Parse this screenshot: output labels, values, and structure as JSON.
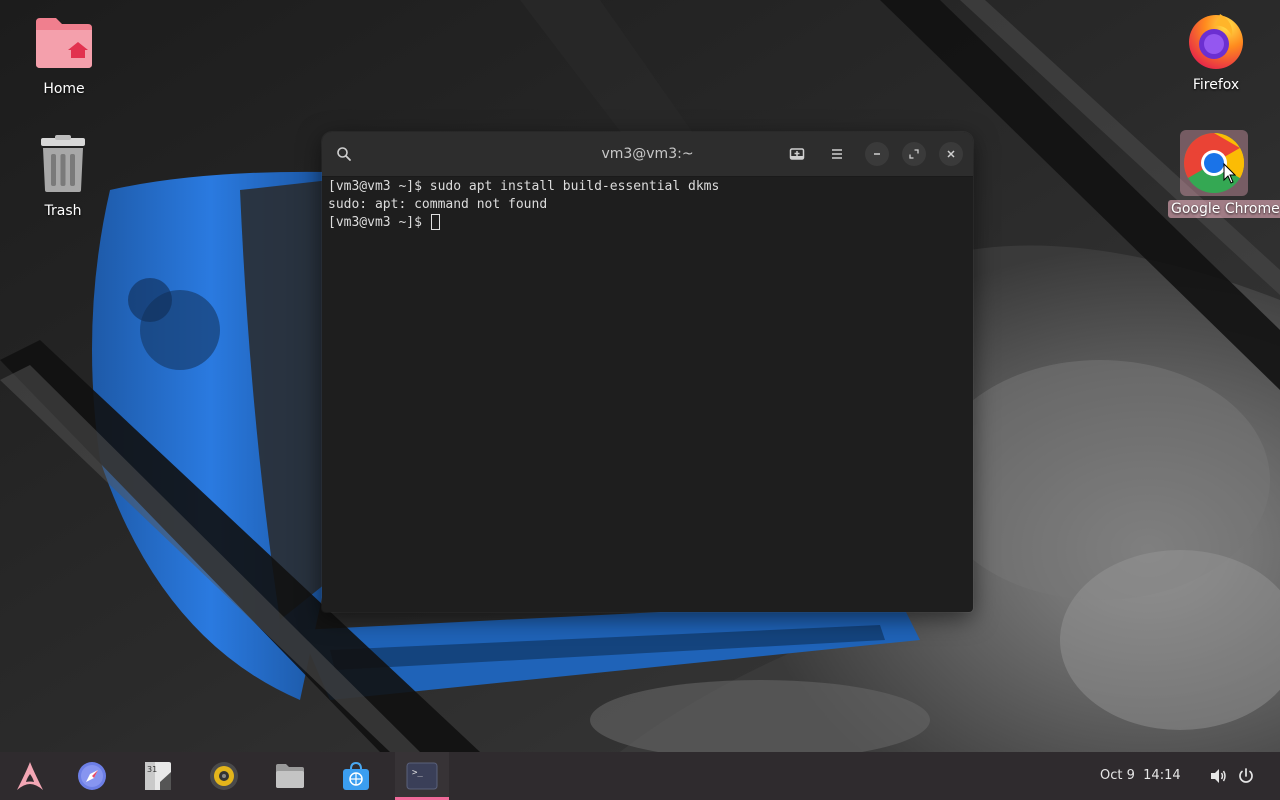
{
  "desktop": {
    "icons": [
      {
        "label": "Home",
        "icon": "folder-home-icon"
      },
      {
        "label": "Trash",
        "icon": "trash-icon"
      },
      {
        "label": "Firefox",
        "icon": "firefox-icon"
      },
      {
        "label": "Google Chrome",
        "icon": "chrome-icon"
      }
    ]
  },
  "terminal": {
    "title": "vm3@vm3:~",
    "lines": [
      "[vm3@vm3 ~]$ sudo apt install build-essential dkms",
      "sudo: apt: command not found",
      "[vm3@vm3 ~]$ "
    ],
    "buttons": [
      "search-icon",
      "new-tab-icon",
      "menu-icon",
      "minimize-icon",
      "maximize-icon",
      "close-icon"
    ]
  },
  "taskbar": {
    "apps": [
      {
        "name": "app-menu",
        "icon": "arch-logo-icon"
      },
      {
        "name": "web-browser",
        "icon": "compass-icon"
      },
      {
        "name": "calendar",
        "icon": "calendar-icon",
        "text": "31"
      },
      {
        "name": "music-player",
        "icon": "speaker-icon"
      },
      {
        "name": "file-manager",
        "icon": "folder-icon"
      },
      {
        "name": "software-store",
        "icon": "store-bag-icon"
      },
      {
        "name": "terminal",
        "icon": "terminal-icon",
        "active": true
      }
    ],
    "clock": {
      "date": "Oct 9",
      "time": "14:14"
    },
    "tray": [
      "volume-icon",
      "power-icon"
    ]
  },
  "colors": {
    "accent": "#f06a9a",
    "terminal_bg": "#1e1e1e",
    "titlebar_bg": "#2d2d2d",
    "taskbar_bg": "#2f2b2e"
  }
}
